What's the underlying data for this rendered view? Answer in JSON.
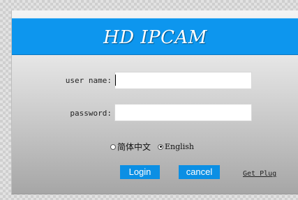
{
  "banner": {
    "title": "HD IPCAM"
  },
  "login_form": {
    "username_label": "user name:",
    "username_value": "",
    "password_label": "password:",
    "password_value": ""
  },
  "language": {
    "options": [
      {
        "label": "简体中文",
        "selected": false
      },
      {
        "label": "English",
        "selected": true
      }
    ]
  },
  "buttons": {
    "login": "Login",
    "cancel": "cancel",
    "get_plugin": "Get Plug"
  },
  "colors": {
    "banner_blue": "#0d96ee",
    "button_blue": "#0b8fe4"
  }
}
